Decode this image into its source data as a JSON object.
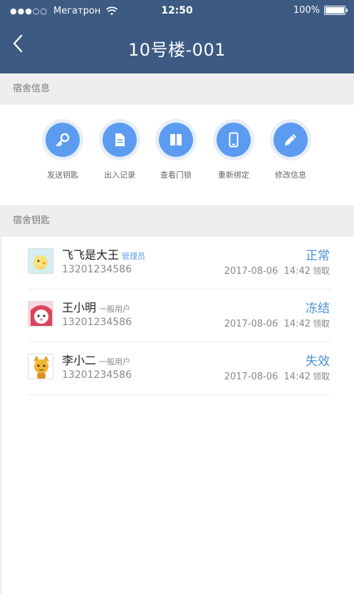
{
  "status_bar": {
    "signal": "●●●○○",
    "carrier": "Мегатрон",
    "time": "12:50",
    "battery": "100%"
  },
  "nav": {
    "title": "10号楼-001"
  },
  "sections": {
    "info": "宿舍信息",
    "keys": "宿舍钥匙"
  },
  "actions": [
    {
      "label": "发送钥匙",
      "icon": "key-icon"
    },
    {
      "label": "出入记录",
      "icon": "document-icon"
    },
    {
      "label": "查看门锁",
      "icon": "door-lock-icon"
    },
    {
      "label": "重新绑定",
      "icon": "phone-icon"
    },
    {
      "label": "修改信息",
      "icon": "pencil-icon"
    }
  ],
  "keys": [
    {
      "name": "飞飞是大王",
      "role": "管理员",
      "phone": "13201234586",
      "status": "正常",
      "date": "2017-08-06",
      "time": "14:42",
      "action": "领取",
      "avatar": "chick-avatar"
    },
    {
      "name": "王小明",
      "role": "一般用户",
      "phone": "13201234586",
      "status": "冻结",
      "date": "2017-08-06",
      "time": "14:42",
      "action": "领取",
      "avatar": "cartoon-girl-avatar"
    },
    {
      "name": "李小二",
      "role": "一般用户",
      "phone": "13201234586",
      "status": "失效",
      "date": "2017-08-06",
      "time": "14:42",
      "action": "领取",
      "avatar": "cartoon-cat-avatar"
    }
  ],
  "colors": {
    "header": "#3c5a82",
    "accent": "#5b9cf1",
    "status": "#4a90d9"
  }
}
